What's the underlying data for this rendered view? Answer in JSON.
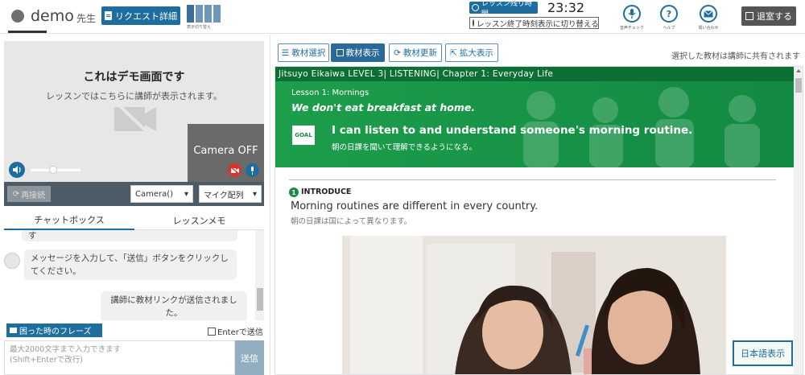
{
  "header": {
    "user_name": "demo",
    "user_suffix": "先生",
    "request_button": "リクエスト詳細",
    "layout_toggle_label": "表示切り替え",
    "timer_label": "レッスン残り時間",
    "timer_value": "23:32",
    "timer_switch_label": "レッスン終了時刻表示に切り替える",
    "audio_check_label": "音声チェック",
    "help_label": "ヘルプ",
    "contact_label": "問い合わせ",
    "exit_button": "退室する"
  },
  "video": {
    "demo_title": "これはデモ画面です",
    "demo_subtitle": "レッスンではこちらに講師が表示されます。",
    "camera_off_text": "Camera OFF",
    "volume_level": 0.45
  },
  "controls": {
    "reconnect_button": "再接続",
    "camera_select": "Camera()",
    "mic_select": "マイク配列"
  },
  "tabs": {
    "chat": "チャットボックス",
    "memo": "レッスンメモ"
  },
  "chat": {
    "partial_message": "す",
    "system_message": "メッセージを入力して、「送信」ボタンをクリックしてください。",
    "sent_message": "講師に教材リンクが送信されました。"
  },
  "composer": {
    "phrase_button": "困った時のフレーズ",
    "enter_to_send_label": "Enterで送信",
    "placeholder": "最大2000文字まで入力できます\n(Shift+Enterで改行)",
    "send_button": "送信"
  },
  "toolbar": {
    "select_material": "教材選択",
    "show_material": "教材表示",
    "update_material": "教材更新",
    "zoom_display": "拡大表示",
    "share_note": "選択した教材は講師に共有されます"
  },
  "lesson": {
    "course_title": "Jitsuyo Eikaiwa LEVEL 3| LISTENING| Chapter 1: Everyday Life",
    "lesson_label": "Lesson 1: Mornings",
    "lesson_phrase": "We don't eat breakfast at home.",
    "goal_badge": "GOAL",
    "goal_en": "I can listen to and understand someone's morning routine.",
    "goal_ja": "朝の日課を聞いて理解できるようになる。",
    "section_number": "1",
    "section_label": "INTRODUCE",
    "intro_en": "Morning routines are different in every country.",
    "intro_ja": "朝の日課は国によって異なります。"
  },
  "japanese_toggle": "日本語表示",
  "colors": {
    "primary": "#1d6e9f",
    "banner_green": "#1d9e4b",
    "banner_dark": "#0c6f33",
    "danger": "#d9342b"
  }
}
